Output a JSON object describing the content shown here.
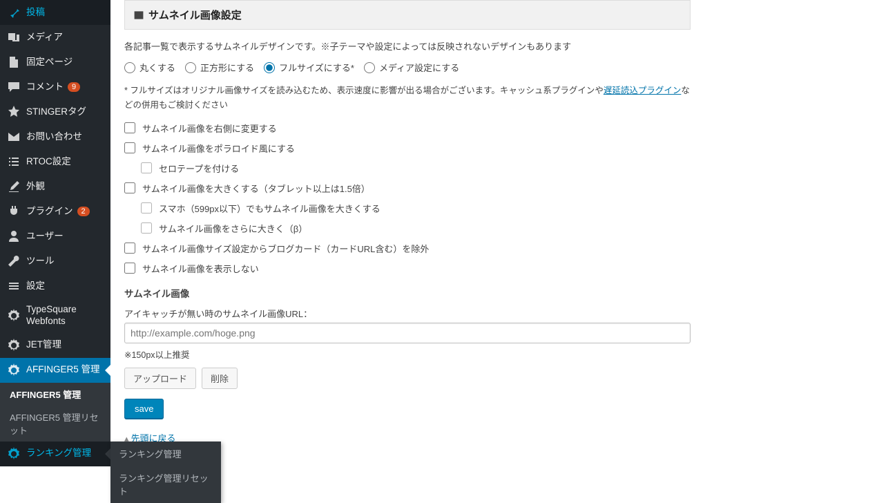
{
  "sidebar": {
    "items": [
      {
        "label": "投稿"
      },
      {
        "label": "メディア"
      },
      {
        "label": "固定ページ"
      },
      {
        "label": "コメント",
        "badge": "9"
      },
      {
        "label": "STINGERタグ"
      },
      {
        "label": "お問い合わせ"
      },
      {
        "label": "RTOC設定"
      },
      {
        "label": "外観"
      },
      {
        "label": "プラグイン",
        "badge": "2"
      },
      {
        "label": "ユーザー"
      },
      {
        "label": "ツール"
      },
      {
        "label": "設定"
      },
      {
        "label": "TypeSquare Webfonts"
      },
      {
        "label": "JET管理"
      },
      {
        "label": "AFFINGER5 管理"
      },
      {
        "label": "ランキング管理"
      }
    ],
    "submenu": [
      {
        "label": "AFFINGER5 管理"
      },
      {
        "label": "AFFINGER5 管理リセット"
      }
    ],
    "flyout": [
      {
        "label": "ランキング管理"
      },
      {
        "label": "ランキング管理リセット"
      }
    ]
  },
  "panel": {
    "title": "サムネイル画像設定",
    "desc": "各記事一覧で表示するサムネイルデザインです。※子テーマや設定によっては反映されないデザインもあります",
    "radios": {
      "round": "丸くする",
      "square": "正方形にする",
      "full": "フルサイズにする*",
      "media": "メディア設定にする"
    },
    "note_prefix": "* フルサイズはオリジナル画像サイズを読み込むため、表示速度に影響が出る場合がございます。キャッシュ系プラグインや",
    "note_link": "遅延読込プラグイン",
    "note_suffix": "などの併用もご検討ください",
    "checks": {
      "right": "サムネイル画像を右側に変更する",
      "polaroid": "サムネイル画像をポラロイド風にする",
      "tape": "セロテープを付ける",
      "bigger": "サムネイル画像を大きくする（タブレット以上は1.5倍）",
      "bigger_sp": "スマホ（599px以下）でもサムネイル画像を大きくする",
      "bigger_more": "サムネイル画像をさらに大きく（β）",
      "exclude_card": "サムネイル画像サイズ設定からブログカード（カードURL含む）を除外",
      "hide": "サムネイル画像を表示しない"
    },
    "subhead": "サムネイル画像",
    "url_label": "アイキャッチが無い時のサムネイル画像URL：",
    "url_placeholder": "http://example.com/hoge.png",
    "url_hint": "※150px以上推奨",
    "btn_upload": "アップロード",
    "btn_delete": "削除",
    "btn_save": "save",
    "backtop": "先頭に戻る"
  }
}
